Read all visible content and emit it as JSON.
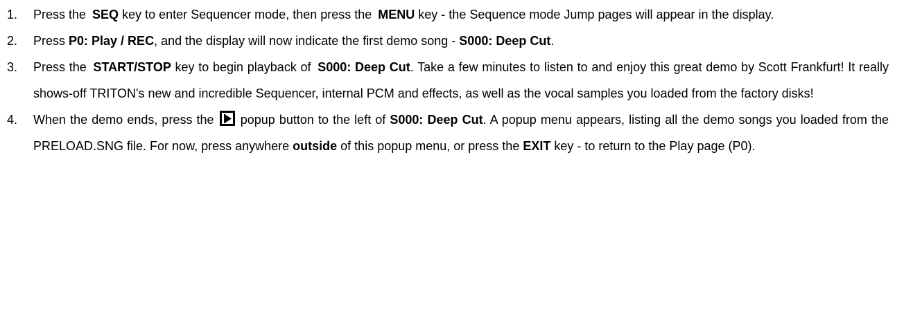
{
  "steps": [
    {
      "num": "1.",
      "t1": "Press the ",
      "b1": "SEQ",
      "t2": " key to enter Sequencer mode, then press the ",
      "b2": "MENU",
      "t3": " key - the Sequence mode Jump pages will appear in the display."
    },
    {
      "num": "2.",
      "t1": "Press ",
      "b1": "P0: Play / REC",
      "t2": ", and the display will now indicate the first demo song - ",
      "b2": "S000: Deep Cut",
      "t3": "."
    },
    {
      "num": "3.",
      "t1": "Press the ",
      "b1": "START/STOP",
      "t2": " key to begin playback of ",
      "b2": "S000: Deep Cut",
      "t3": ". Take a few minutes to listen to and enjoy this great demo by Scott Frankfurt! It really shows-off TRITON's new and incredible Sequencer, internal PCM and effects, as well as the vocal samples you loaded from the factory disks!"
    },
    {
      "num": "4.",
      "t1": "When the demo ends, press the ",
      "icon": "play-popup-icon",
      "t2": " popup button to the left of ",
      "b1": "S000: Deep Cut",
      "t3": ". A popup menu appears, listing all the demo songs you loaded from the PRELOAD.SNG file. For now, press anywhere ",
      "b2": "outside",
      "t4": " of this popup menu, or press the ",
      "b3": "EXIT",
      "t5": " key - to return to the Play page (P0)."
    }
  ]
}
